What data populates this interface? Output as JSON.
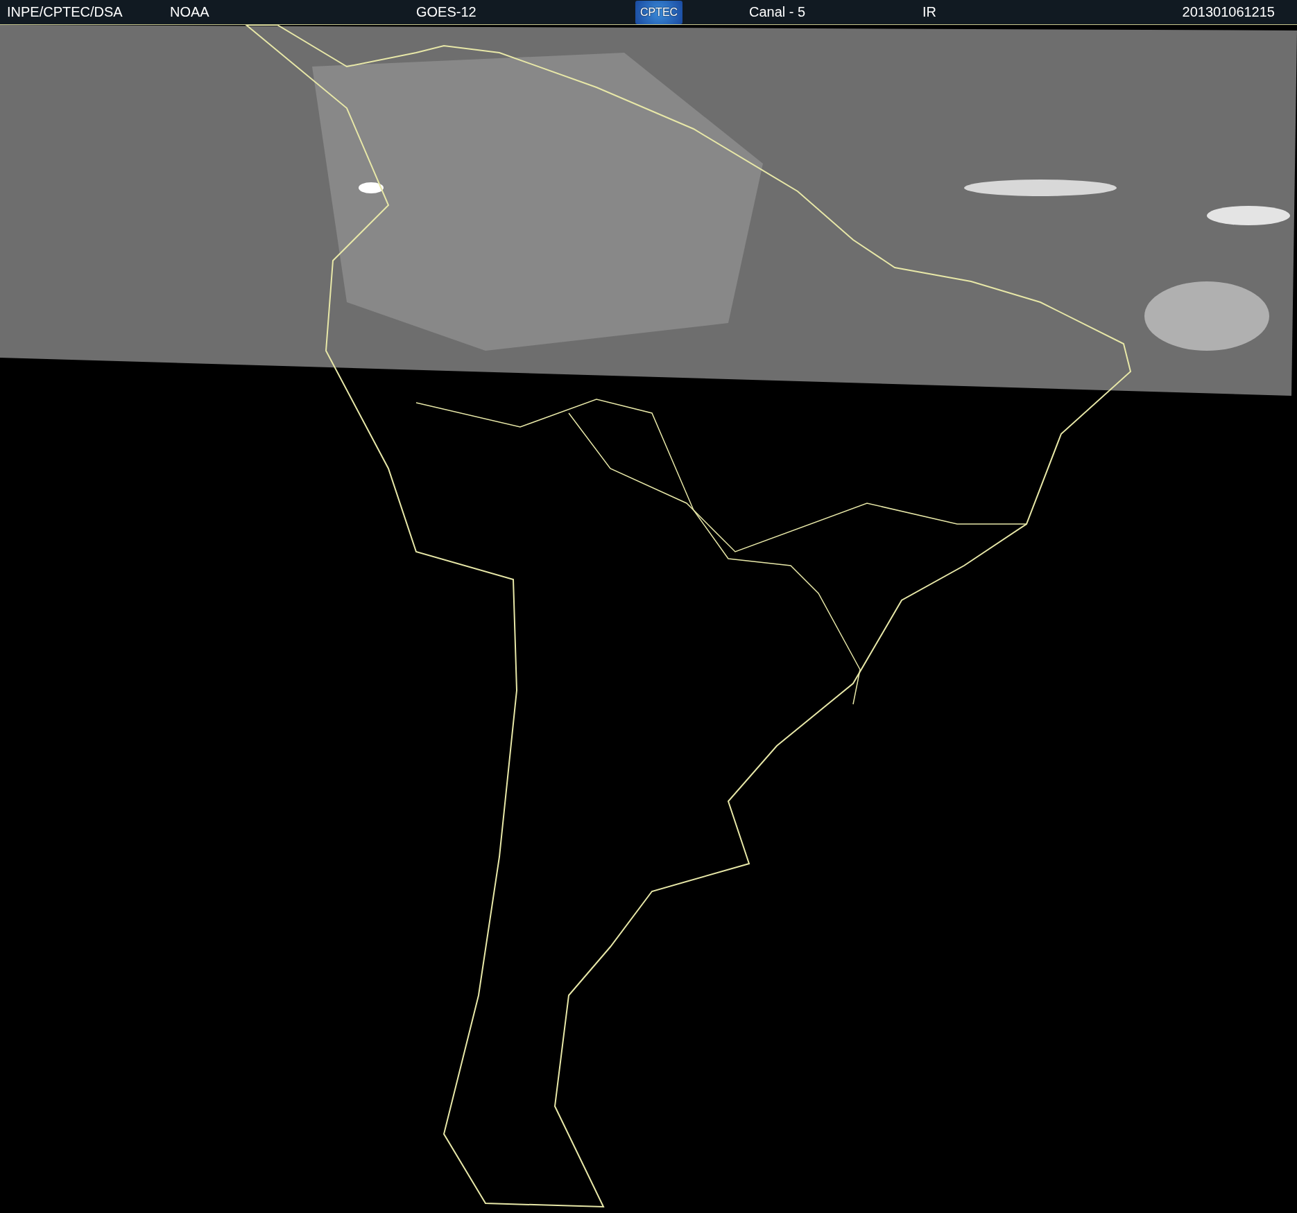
{
  "header": {
    "items": [
      {
        "kind": "text",
        "text": "INPE/CPTEC/DSA"
      },
      {
        "kind": "text",
        "text": "NOAA"
      },
      {
        "kind": "text",
        "text": "GOES-12"
      },
      {
        "kind": "logo",
        "text": "CPTEC"
      },
      {
        "kind": "text",
        "text": "Canal - 5"
      },
      {
        "kind": "text",
        "text": "IR"
      },
      {
        "kind": "text",
        "text": "201301061215"
      }
    ]
  }
}
